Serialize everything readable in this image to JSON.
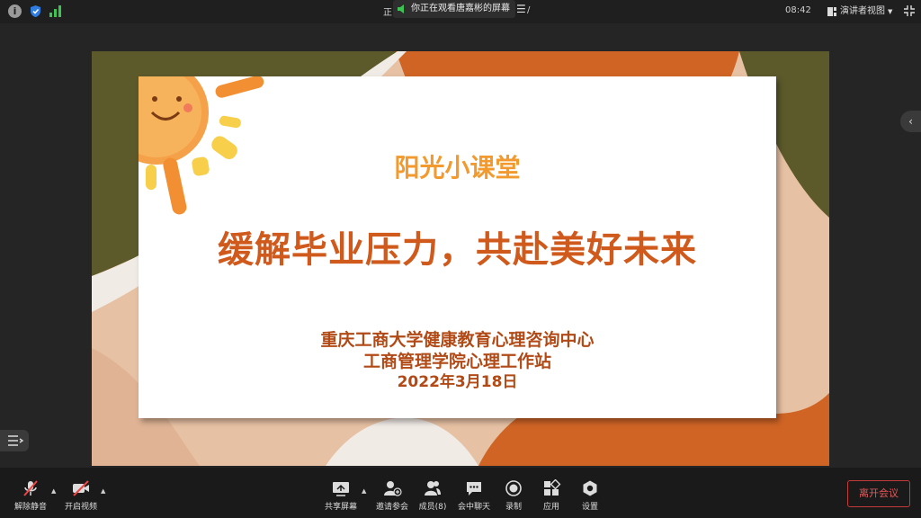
{
  "topbar": {
    "info_icon": "info-icon",
    "share_banner_text": "你正在观看唐嘉彬的屏幕",
    "clock": "08:42",
    "view_switch_label": "演讲者视图",
    "fragment_left": "正",
    "fragment_right": "/"
  },
  "slide": {
    "course_title": "阳光小课堂",
    "main_title": "缓解毕业压力，共赴美好未来",
    "org_line_1": "重庆工商大学健康教育心理咨询中心",
    "org_line_2": "工商管理学院心理工作站",
    "date": "2022年3月18日",
    "colors": {
      "orange": "#f29a2e",
      "rust": "#d0591c",
      "olive": "#5c5a2b",
      "peach": "#e7c1a3"
    }
  },
  "toolbar": {
    "unmute_label": "解除静音",
    "start_video_label": "开启视频",
    "share_screen_label": "共享屏幕",
    "invite_label": "邀请参会",
    "members_label": "成员(8)",
    "chat_label": "会中聊天",
    "record_label": "录制",
    "apps_label": "应用",
    "settings_label": "设置",
    "leave_label": "离开会议"
  }
}
